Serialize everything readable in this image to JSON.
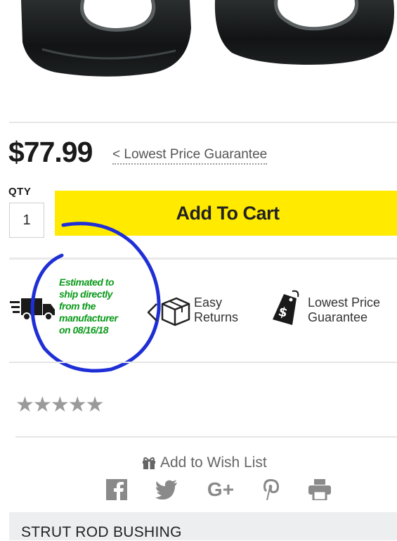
{
  "price": "$77.99",
  "price_guarantee_link": "< Lowest Price Guarantee",
  "qty": {
    "label": "QTY",
    "value": "1"
  },
  "add_to_cart": "Add To Cart",
  "shipping_note": {
    "line1": "Estimated to",
    "line2": "ship directly",
    "line3": "from the",
    "line4": "manufacturer",
    "line5": "on 08/16/18"
  },
  "features": {
    "easy_returns": {
      "line1": "Easy",
      "line2": "Returns",
      "icon": "box-return-icon"
    },
    "lowest_price": {
      "line1": "Lowest Price",
      "line2": "Guarantee",
      "icon": "price-tag-icon"
    },
    "shipping": {
      "icon": "truck-icon"
    }
  },
  "rating": {
    "stars": 0,
    "max": 5
  },
  "wish_list": "Add to Wish List",
  "share_icons": [
    "facebook-icon",
    "twitter-icon",
    "google-plus-icon",
    "pinterest-icon",
    "print-icon"
  ],
  "product_section": "STRUT ROD BUSHING",
  "colors": {
    "cart_button": "#ffea00",
    "shipping_note": "#0a9a1a",
    "annotation_circle": "#1f2fd6"
  }
}
